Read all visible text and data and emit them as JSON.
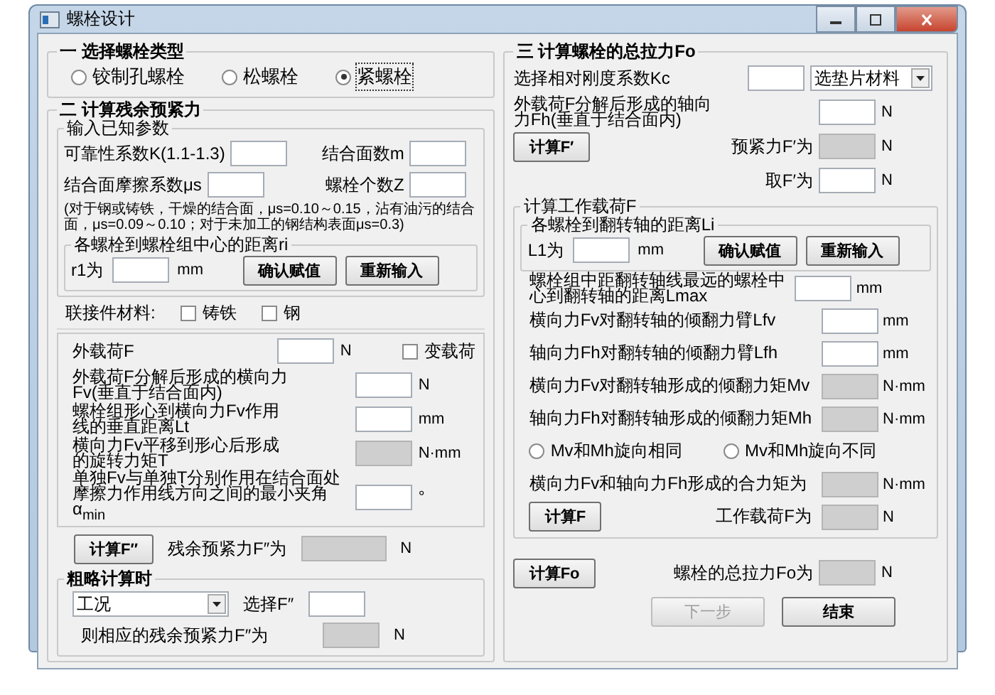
{
  "window": {
    "title": "螺栓设计"
  },
  "bolt_type": {
    "title": "一 选择螺栓类型",
    "options": [
      {
        "label": "铰制孔螺栓",
        "selected": false
      },
      {
        "label": "松螺栓",
        "selected": false
      },
      {
        "label": "紧螺栓",
        "selected": true
      }
    ]
  },
  "residual": {
    "title": "二 计算残余预紧力",
    "known": {
      "title": "输入已知参数",
      "rows": [
        [
          {
            "kind": "label",
            "text": "可靠性系数K(1.1-1.3)"
          },
          {
            "kind": "input",
            "disabled": false
          },
          {
            "kind": "label",
            "text": "结合面数m"
          },
          {
            "kind": "input",
            "disabled": false
          }
        ],
        [
          {
            "kind": "label",
            "text": "结合面摩擦系数μs"
          },
          {
            "kind": "input",
            "disabled": false
          },
          {
            "kind": "label",
            "text": "螺栓个数Z"
          },
          {
            "kind": "input",
            "disabled": false
          }
        ]
      ],
      "note": "(对于钢或铸铁，干燥的结合面，μs=0.10～0.15，沾有油污的结合面，μs=0.09～0.10；对于未加工的钢结构表面μs=0.3)",
      "distance": {
        "title": "各螺栓到螺栓组中心的距离ri",
        "row": [
          {
            "kind": "text",
            "text": "r1为"
          },
          {
            "kind": "input",
            "disabled": false
          },
          {
            "kind": "unit",
            "text": "mm"
          },
          {
            "kind": "button",
            "label": "确认赋值",
            "disabled": false
          },
          {
            "kind": "button",
            "label": "重新输入",
            "disabled": false
          }
        ]
      }
    },
    "material": [
      {
        "kind": "text",
        "text": "联接件材料:"
      },
      {
        "kind": "checkbox",
        "label": "铸铁",
        "checked": false
      },
      {
        "kind": "checkbox",
        "label": "钢",
        "checked": false
      }
    ],
    "load_rows": [
      [
        {
          "kind": "label",
          "text": "外载荷F"
        },
        {
          "kind": "input",
          "disabled": false
        },
        {
          "kind": "unit",
          "text": "N"
        },
        {
          "kind": "checkbox",
          "label": "变载荷",
          "checked": false
        }
      ],
      [
        {
          "kind": "label",
          "text": "外载荷F分解后形成的横向力Fv(垂直于结合面内)"
        },
        {
          "kind": "input",
          "disabled": false
        },
        {
          "kind": "unit",
          "text": "N"
        }
      ],
      [
        {
          "kind": "label",
          "text": "螺栓组形心到横向力Fv作用线的垂直距离Lt"
        },
        {
          "kind": "input",
          "disabled": false
        },
        {
          "kind": "unit",
          "text": "mm"
        }
      ],
      [
        {
          "kind": "label",
          "text": "横向力Fv平移到形心后形成的旋转力矩T"
        },
        {
          "kind": "input",
          "disabled": true
        },
        {
          "kind": "unit",
          "text": "N·mm"
        }
      ],
      [
        {
          "kind": "label",
          "text": "单独Fv与单独T分别作用在结合面处摩擦力作用线方向之间的最小夹角α$_{min}$"
        },
        {
          "kind": "input",
          "disabled": false
        },
        {
          "kind": "unit",
          "text": "°"
        }
      ]
    ],
    "calc_row": [
      {
        "kind": "button",
        "label": "计算F″",
        "disabled": false
      },
      {
        "kind": "text",
        "text": "残余预紧力F″为"
      },
      {
        "kind": "input",
        "disabled": true
      },
      {
        "kind": "unit",
        "text": "N"
      }
    ],
    "rough": {
      "title": "粗略计算时",
      "rows": [
        [
          {
            "kind": "select",
            "value": "工况"
          },
          {
            "kind": "text",
            "text": "选择F″"
          },
          {
            "kind": "input",
            "disabled": false
          }
        ],
        [
          {
            "kind": "label",
            "text": "则相应的残余预紧力F″为"
          },
          {
            "kind": "input",
            "disabled": true
          },
          {
            "kind": "unit",
            "text": "N"
          }
        ]
      ]
    }
  },
  "total": {
    "title": "三 计算螺栓的总拉力Fo",
    "rows": [
      [
        {
          "kind": "label",
          "text": "选择相对刚度系数Kc"
        },
        {
          "kind": "input",
          "disabled": false
        },
        {
          "kind": "select",
          "value": "选垫片材料"
        }
      ],
      [
        {
          "kind": "label",
          "text": "外载荷F分解后形成的轴向力Fh(垂直于结合面内)"
        },
        {
          "kind": "input",
          "disabled": false
        },
        {
          "kind": "unit",
          "text": "N"
        }
      ]
    ],
    "preload_row": [
      {
        "kind": "button",
        "label": "计算F′",
        "disabled": false
      },
      {
        "kind": "rlabel",
        "text": "预紧力F′为"
      },
      {
        "kind": "input",
        "disabled": true
      },
      {
        "kind": "unit",
        "text": "N"
      }
    ],
    "take_row": [
      {
        "kind": "rlabel",
        "text": "取F′为"
      },
      {
        "kind": "input",
        "disabled": false
      },
      {
        "kind": "unit",
        "text": "N"
      }
    ],
    "work": {
      "title": "计算工作载荷F",
      "distance": {
        "title": "各螺栓到翻转轴的距离Li",
        "row": [
          {
            "kind": "text",
            "text": "L1为"
          },
          {
            "kind": "input",
            "disabled": false
          },
          {
            "kind": "unit",
            "text": "mm"
          },
          {
            "kind": "button",
            "label": "确认赋值",
            "disabled": false
          },
          {
            "kind": "button",
            "label": "重新输入",
            "disabled": false
          }
        ]
      },
      "rows": [
        [
          {
            "kind": "label",
            "text": "螺栓组中距翻转轴线最远的螺栓中心到翻转轴的距离Lmax"
          },
          {
            "kind": "input",
            "disabled": false
          },
          {
            "kind": "unit",
            "text": "mm"
          }
        ],
        [
          {
            "kind": "label",
            "text": "横向力Fv对翻转轴的倾翻力臂Lfv"
          },
          {
            "kind": "input",
            "disabled": false
          },
          {
            "kind": "unit",
            "text": "mm"
          }
        ],
        [
          {
            "kind": "label",
            "text": "轴向力Fh对翻转轴的倾翻力臂Lfh"
          },
          {
            "kind": "input",
            "disabled": false
          },
          {
            "kind": "unit",
            "text": "mm"
          }
        ],
        [
          {
            "kind": "label",
            "text": "横向力Fv对翻转轴形成的倾翻力矩Mv"
          },
          {
            "kind": "input",
            "disabled": true
          },
          {
            "kind": "unit",
            "text": "N·mm"
          }
        ],
        [
          {
            "kind": "label",
            "text": "轴向力Fh对翻转轴形成的倾翻力矩Mh"
          },
          {
            "kind": "input",
            "disabled": true
          },
          {
            "kind": "unit",
            "text": "N·mm"
          }
        ],
        [
          {
            "kind": "radio",
            "label": "Mv和Mh旋向相同",
            "selected": false
          },
          {
            "kind": "radio",
            "label": "Mv和Mh旋向不同",
            "selected": false
          }
        ],
        [
          {
            "kind": "label",
            "text": "横向力Fv和轴向力Fh形成的合力矩为"
          },
          {
            "kind": "input",
            "disabled": true
          },
          {
            "kind": "unit",
            "text": "N·mm"
          }
        ],
        [
          {
            "kind": "button",
            "label": "计算F",
            "disabled": false
          },
          {
            "kind": "rlabel",
            "text": "工作载荷F为"
          },
          {
            "kind": "input",
            "disabled": true
          },
          {
            "kind": "unit",
            "text": "N"
          }
        ]
      ]
    },
    "calc_row": [
      {
        "kind": "button",
        "label": "计算Fo",
        "disabled": false
      },
      {
        "kind": "rlabel",
        "text": "螺栓的总拉力Fo为"
      },
      {
        "kind": "input",
        "disabled": true
      },
      {
        "kind": "unit",
        "text": "N"
      }
    ],
    "footer": [
      {
        "kind": "button",
        "label": "下一步",
        "disabled": true
      },
      {
        "kind": "button",
        "label": "结束",
        "disabled": false
      }
    ]
  }
}
